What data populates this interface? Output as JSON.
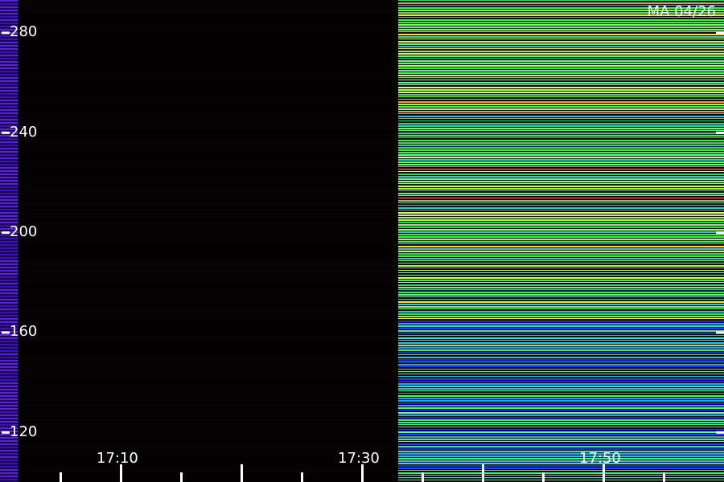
{
  "chart_data": {
    "type": "heatmap",
    "title": "",
    "annotation": "MA 04/26",
    "xlabel": "",
    "ylabel": "",
    "x_range": [
      "17:00",
      "17:60"
    ],
    "x_ticks": [
      {
        "value": "17:10",
        "label": "17:10"
      },
      {
        "value": "17:30",
        "label": "17:30"
      },
      {
        "value": "17:50",
        "label": "17:50"
      }
    ],
    "y_range": [
      100,
      293
    ],
    "y_ticks": [
      120,
      160,
      200,
      240,
      280
    ],
    "segments": [
      {
        "start": "17:00",
        "end": "17:01.5",
        "description_color": "#5a20d0"
      },
      {
        "start": "17:01.5",
        "end": "17:33",
        "description_color": "#050205"
      },
      {
        "start": "17:33",
        "end": "17:60",
        "description_color": "#30e070"
      }
    ],
    "colors": {
      "background": "#000000",
      "low": "#2a10a0",
      "mid": "#20c0e0",
      "high": "#40ff40",
      "peak": "#ffe040",
      "labels": "#ffffff"
    },
    "grid": false
  }
}
